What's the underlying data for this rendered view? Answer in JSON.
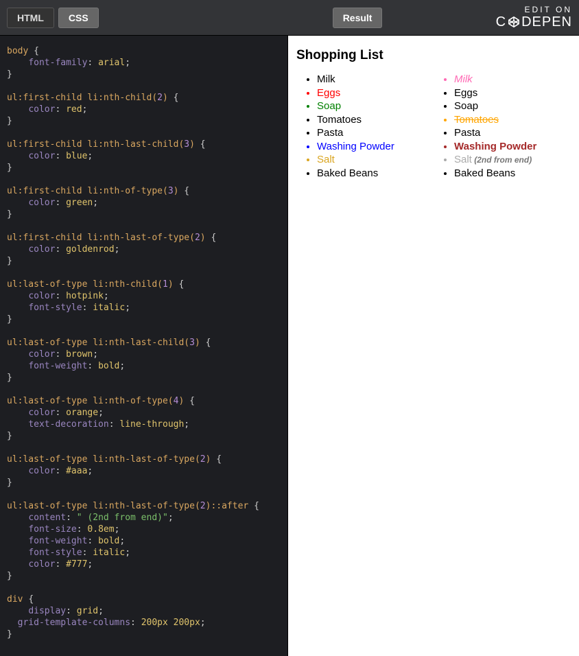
{
  "topbar": {
    "tab_html": "HTML",
    "tab_css": "CSS",
    "tab_result": "Result",
    "edit_line1": "EDIT ON",
    "edit_brand_left": "C",
    "edit_brand_right": "DEPEN"
  },
  "code": {
    "rules": [
      {
        "selector": "body",
        "props": [
          {
            "prop": "font-family",
            "val": "arial"
          }
        ]
      },
      {
        "selector_parts": [
          "ul",
          ":first-child",
          " li",
          ":nth-child(",
          "2",
          ")"
        ],
        "props": [
          {
            "prop": "color",
            "val": "red"
          }
        ]
      },
      {
        "selector_parts": [
          "ul",
          ":first-child",
          " li",
          ":nth-last-child(",
          "3",
          ")"
        ],
        "props": [
          {
            "prop": "color",
            "val": "blue"
          }
        ]
      },
      {
        "selector_parts": [
          "ul",
          ":first-child",
          " li",
          ":nth-of-type(",
          "3",
          ")"
        ],
        "props": [
          {
            "prop": "color",
            "val": "green"
          }
        ]
      },
      {
        "selector_parts": [
          "ul",
          ":first-child",
          " li",
          ":nth-last-of-type(",
          "2",
          ")"
        ],
        "props": [
          {
            "prop": "color",
            "val": "goldenrod"
          }
        ]
      },
      {
        "selector_parts": [
          "ul",
          ":last-of-type",
          " li",
          ":nth-child(",
          "1",
          ")"
        ],
        "props": [
          {
            "prop": "color",
            "val": "hotpink"
          },
          {
            "prop": "font-style",
            "val": "italic"
          }
        ]
      },
      {
        "selector_parts": [
          "ul",
          ":last-of-type",
          " li",
          ":nth-last-child(",
          "3",
          ")"
        ],
        "props": [
          {
            "prop": "color",
            "val": "brown"
          },
          {
            "prop": "font-weight",
            "val": "bold"
          }
        ]
      },
      {
        "selector_parts": [
          "ul",
          ":last-of-type",
          " li",
          ":nth-of-type(",
          "4",
          ")"
        ],
        "props": [
          {
            "prop": "color",
            "val": "orange"
          },
          {
            "prop": "text-decoration",
            "val": "line-through"
          }
        ]
      },
      {
        "selector_parts": [
          "ul",
          ":last-of-type",
          " li",
          ":nth-last-of-type(",
          "2",
          ")"
        ],
        "props": [
          {
            "prop": "color",
            "val": "#aaa"
          }
        ]
      },
      {
        "selector_parts": [
          "ul",
          ":last-of-type",
          " li",
          ":nth-last-of-type(",
          "2",
          ")",
          "::after"
        ],
        "props": [
          {
            "prop": "content",
            "val": "\" (2nd from end)\"",
            "string": true
          },
          {
            "prop": "font-size",
            "val": "0.8em"
          },
          {
            "prop": "font-weight",
            "val": "bold"
          },
          {
            "prop": "font-style",
            "val": "italic"
          },
          {
            "prop": "color",
            "val": "#777"
          }
        ]
      },
      {
        "selector": "div",
        "props": [
          {
            "prop": "display",
            "val": "grid"
          },
          {
            "prop": "grid-template-columns",
            "val": "200px 200px",
            "two_indent": true
          }
        ]
      }
    ]
  },
  "result": {
    "heading": "Shopping List",
    "list1": [
      {
        "cls": "",
        "label": "Milk"
      },
      {
        "cls": "eggs",
        "label": "Eggs"
      },
      {
        "cls": "soap",
        "label": "Soap"
      },
      {
        "cls": "",
        "label": "Tomatoes"
      },
      {
        "cls": "",
        "label": "Pasta"
      },
      {
        "cls": "wash",
        "label": "Washing Powder"
      },
      {
        "cls": "salt",
        "label": "Salt"
      },
      {
        "cls": "",
        "label": "Baked Beans"
      }
    ],
    "list2": [
      {
        "cls": "milk",
        "label": "Milk"
      },
      {
        "cls": "",
        "label": "Eggs"
      },
      {
        "cls": "",
        "label": "Soap"
      },
      {
        "cls": "toma",
        "label": "Tomatoes"
      },
      {
        "cls": "",
        "label": "Pasta"
      },
      {
        "cls": "wash",
        "label": "Washing Powder"
      },
      {
        "cls": "salt",
        "label": "Salt",
        "after": " (2nd from end)"
      },
      {
        "cls": "",
        "label": "Baked Beans"
      }
    ]
  }
}
